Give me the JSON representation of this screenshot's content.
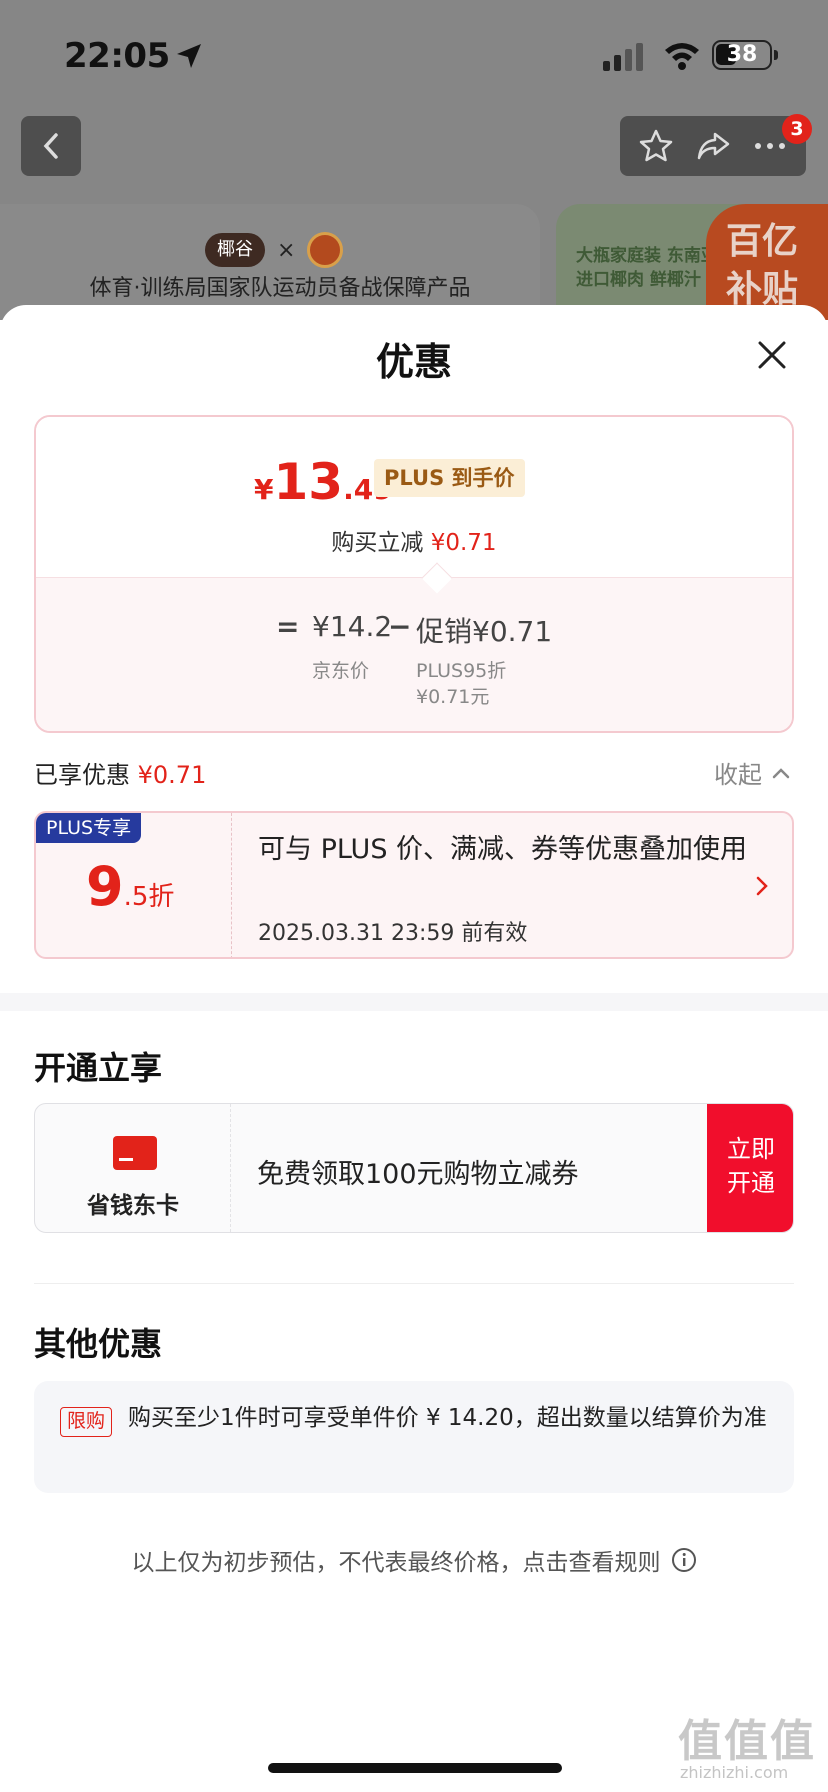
{
  "status_bar": {
    "time": "22:05",
    "battery": "38"
  },
  "nav": {
    "cart_badge": "3"
  },
  "background": {
    "brand_logo": "椰谷",
    "brand_x": "×",
    "slogan": "体育·训练局国家队运动员备战保障产品",
    "right_banner": "大瓶家庭装 东南亚进口椰肉 鲜椰汁",
    "subsidy": "百亿补贴"
  },
  "sheet": {
    "title": "优惠",
    "price": {
      "yen": "¥",
      "int": "13",
      "dec": ".49",
      "tag": "PLUS 到手价"
    },
    "reduce": {
      "label": "购买立减",
      "amount": "¥0.71"
    },
    "calc": {
      "eq": "=",
      "jd_price": "¥14.2",
      "minus": "−",
      "promo": "促销¥0.71",
      "jd_label": "京东价",
      "plus_line1": "PLUS95折",
      "plus_line2": "¥0.71元"
    },
    "enjoyed": {
      "label": "已享优惠",
      "amount": "¥0.71",
      "collapse": "收起"
    },
    "coupon": {
      "tag": "PLUS专享",
      "discount_big": "9",
      "discount_small": ".5折",
      "desc": "可与 PLUS 价、满减、券等优惠叠加使用",
      "valid": "2025.03.31 23:59 前有效"
    },
    "open_section": {
      "title": "开通立享",
      "card_name": "省钱东卡",
      "desc": "免费领取100元购物立减券",
      "button": "立即开通"
    },
    "other_section": {
      "title": "其他优惠",
      "tag": "限购",
      "text": "购买至少1件时可享受单件价 ¥ 14.20，超出数量以结算价为准"
    },
    "disclaimer": "以上仅为初步预估，不代表最终价格，点击查看规则"
  },
  "watermark": {
    "main": "值值值",
    "sub": "zhizhizhi.com"
  }
}
